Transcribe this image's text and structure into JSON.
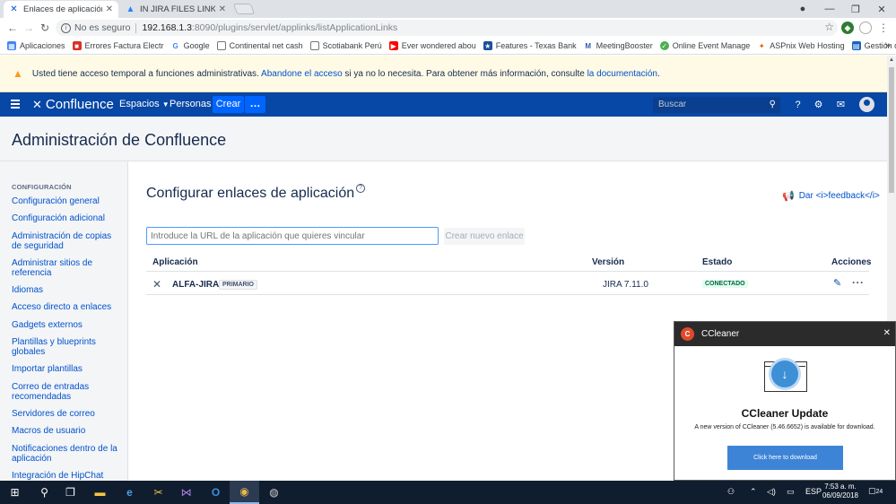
{
  "browser": {
    "tabs": [
      {
        "title": "Enlaces de aplicación - A",
        "active": true
      },
      {
        "title": "IN JIRA FILES LINKS ARE",
        "active": false
      }
    ],
    "address": {
      "insecure_label": "No es seguro",
      "host": "192.168.1.3",
      "path": ":8090/plugins/servlet/applinks/listApplicationLinks"
    },
    "bookmarks": [
      {
        "label": "Aplicaciones",
        "icon": "apps-grid-icon",
        "color": "#4285f4"
      },
      {
        "label": "Errores Factura Electr",
        "icon": "bookmark-icon",
        "color": "#d93025"
      },
      {
        "label": "Google",
        "icon": "google-icon",
        "color": "#4285f4"
      },
      {
        "label": "Continental net cash",
        "icon": "page-icon",
        "color": "#777777"
      },
      {
        "label": "Scotiabank Perú",
        "icon": "page-icon",
        "color": "#777777"
      },
      {
        "label": "Ever wondered abou",
        "icon": "youtube-icon",
        "color": "#ff0000"
      },
      {
        "label": "Features - Texas Bank",
        "icon": "flag-icon",
        "color": "#1a4f9c"
      },
      {
        "label": "MeetingBooster",
        "icon": "meeting-icon",
        "color": "#2b5fa8"
      },
      {
        "label": "Online Event Manage",
        "icon": "event-icon",
        "color": "#4caf50"
      },
      {
        "label": "ASPnix Web Hosting",
        "icon": "aspnix-icon",
        "color": "#e65100"
      },
      {
        "label": "Gestión documental",
        "icon": "docs-icon",
        "color": "#1565c0"
      }
    ]
  },
  "banner": {
    "text_before": "Usted tiene acceso temporal a funciones administrativas. ",
    "link1": "Abandone el acceso",
    "text_middle": " si ya no lo necesita. Para obtener más información, consulte ",
    "link2": "la documentación",
    "text_after": "."
  },
  "header": {
    "brand": "Confluence",
    "nav": [
      "Espacios",
      "Personas"
    ],
    "create": "Crear",
    "more": "…",
    "search_placeholder": "Buscar"
  },
  "admin_title": "Administración de Confluence",
  "sidebar": {
    "section": "CONFIGURACIÓN",
    "items": [
      "Configuración general",
      "Configuración adicional",
      "Administración de copias de seguridad",
      "Administrar sitios de referencia",
      "Idiomas",
      "Acceso directo a enlaces",
      "Gadgets externos",
      "Plantillas y blueprints globales",
      "Importar plantillas",
      "Correo de entradas recomendadas",
      "Servidores de correo",
      "Macros de usuario",
      "Notificaciones dentro de la aplicación",
      "Integración de HipChat"
    ]
  },
  "main": {
    "title": "Configurar enlaces de aplicación",
    "feedback": "Dar <i>feedback</i>",
    "url_placeholder": "Introduce la URL de la aplicación que quieres vincular",
    "new_link_button": "Crear nuevo enlace",
    "table": {
      "headers": [
        "Aplicación",
        "Versión",
        "Estado",
        "Acciones"
      ],
      "rows": [
        {
          "name": "ALFA-JIRA",
          "badge": "PRIMARIO",
          "version": "JIRA 7.11.0",
          "status": "CONECTADO"
        }
      ]
    }
  },
  "ccleaner": {
    "app": "CCleaner",
    "heading": "CCleaner Update",
    "message": "A new version of CCleaner (5.46.6652) is available for download.",
    "button": "Click here to download"
  },
  "taskbar": {
    "language": "ESP",
    "time": "7:53 a. m.",
    "date": "06/09/2018",
    "notifications": "24"
  }
}
